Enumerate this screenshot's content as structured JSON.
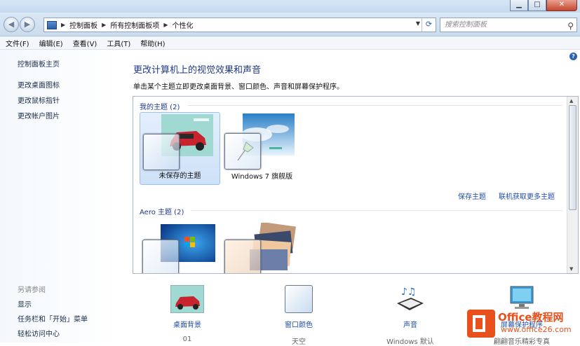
{
  "window": {
    "min": "▁",
    "max": "□",
    "close": "✕"
  },
  "address": {
    "crumbs": [
      "控制面板",
      "所有控制面板项",
      "个性化"
    ],
    "search_placeholder": "搜索控制面板"
  },
  "menu": [
    "文件(F)",
    "编辑(E)",
    "查看(V)",
    "工具(T)",
    "帮助(H)"
  ],
  "sidebar": {
    "links": [
      "控制面板主页",
      "更改桌面图标",
      "更改鼠标指针",
      "更改帐户图片"
    ],
    "see_also_title": "另请参阅",
    "see_also": [
      "显示",
      "任务栏和「开始」菜单",
      "轻松访问中心"
    ]
  },
  "main": {
    "title": "更改计算机上的视觉效果和声音",
    "subtitle": "单击某个主题立即更改桌面背景、窗口颜色、声音和屏幕保护程序。",
    "my_themes_header": "我的主题 (2)",
    "themes": [
      "未保存的主题",
      "Windows 7 旗舰版"
    ],
    "save_theme": "保存主题",
    "get_more": "联机获取更多主题",
    "aero_header": "Aero 主题 (2)"
  },
  "bottom": [
    {
      "title": "桌面背景",
      "value": "01"
    },
    {
      "title": "窗口颜色",
      "value": "天空"
    },
    {
      "title": "声音",
      "value": "Windows 默认"
    },
    {
      "title": "屏幕保护程序",
      "value": "翩翩音乐精彩专真"
    }
  ],
  "watermark": {
    "brand": "Office教程网",
    "url": "www.office26.com"
  },
  "colors": {
    "link": "#1f4da5",
    "header": "#1e3a8a",
    "accent": "#e8501c"
  }
}
